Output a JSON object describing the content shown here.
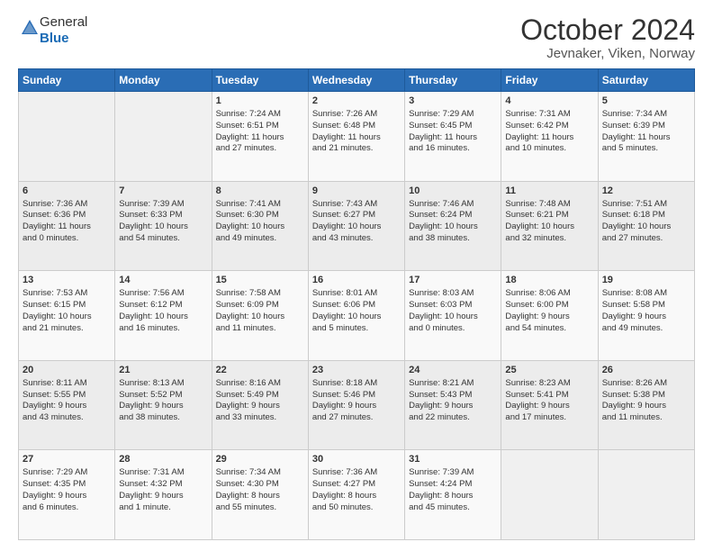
{
  "header": {
    "logo_line1": "General",
    "logo_line2": "Blue",
    "title": "October 2024",
    "subtitle": "Jevnaker, Viken, Norway"
  },
  "days_of_week": [
    "Sunday",
    "Monday",
    "Tuesday",
    "Wednesday",
    "Thursday",
    "Friday",
    "Saturday"
  ],
  "weeks": [
    [
      {
        "day": "",
        "content": ""
      },
      {
        "day": "",
        "content": ""
      },
      {
        "day": "1",
        "content": "Sunrise: 7:24 AM\nSunset: 6:51 PM\nDaylight: 11 hours\nand 27 minutes."
      },
      {
        "day": "2",
        "content": "Sunrise: 7:26 AM\nSunset: 6:48 PM\nDaylight: 11 hours\nand 21 minutes."
      },
      {
        "day": "3",
        "content": "Sunrise: 7:29 AM\nSunset: 6:45 PM\nDaylight: 11 hours\nand 16 minutes."
      },
      {
        "day": "4",
        "content": "Sunrise: 7:31 AM\nSunset: 6:42 PM\nDaylight: 11 hours\nand 10 minutes."
      },
      {
        "day": "5",
        "content": "Sunrise: 7:34 AM\nSunset: 6:39 PM\nDaylight: 11 hours\nand 5 minutes."
      }
    ],
    [
      {
        "day": "6",
        "content": "Sunrise: 7:36 AM\nSunset: 6:36 PM\nDaylight: 11 hours\nand 0 minutes."
      },
      {
        "day": "7",
        "content": "Sunrise: 7:39 AM\nSunset: 6:33 PM\nDaylight: 10 hours\nand 54 minutes."
      },
      {
        "day": "8",
        "content": "Sunrise: 7:41 AM\nSunset: 6:30 PM\nDaylight: 10 hours\nand 49 minutes."
      },
      {
        "day": "9",
        "content": "Sunrise: 7:43 AM\nSunset: 6:27 PM\nDaylight: 10 hours\nand 43 minutes."
      },
      {
        "day": "10",
        "content": "Sunrise: 7:46 AM\nSunset: 6:24 PM\nDaylight: 10 hours\nand 38 minutes."
      },
      {
        "day": "11",
        "content": "Sunrise: 7:48 AM\nSunset: 6:21 PM\nDaylight: 10 hours\nand 32 minutes."
      },
      {
        "day": "12",
        "content": "Sunrise: 7:51 AM\nSunset: 6:18 PM\nDaylight: 10 hours\nand 27 minutes."
      }
    ],
    [
      {
        "day": "13",
        "content": "Sunrise: 7:53 AM\nSunset: 6:15 PM\nDaylight: 10 hours\nand 21 minutes."
      },
      {
        "day": "14",
        "content": "Sunrise: 7:56 AM\nSunset: 6:12 PM\nDaylight: 10 hours\nand 16 minutes."
      },
      {
        "day": "15",
        "content": "Sunrise: 7:58 AM\nSunset: 6:09 PM\nDaylight: 10 hours\nand 11 minutes."
      },
      {
        "day": "16",
        "content": "Sunrise: 8:01 AM\nSunset: 6:06 PM\nDaylight: 10 hours\nand 5 minutes."
      },
      {
        "day": "17",
        "content": "Sunrise: 8:03 AM\nSunset: 6:03 PM\nDaylight: 10 hours\nand 0 minutes."
      },
      {
        "day": "18",
        "content": "Sunrise: 8:06 AM\nSunset: 6:00 PM\nDaylight: 9 hours\nand 54 minutes."
      },
      {
        "day": "19",
        "content": "Sunrise: 8:08 AM\nSunset: 5:58 PM\nDaylight: 9 hours\nand 49 minutes."
      }
    ],
    [
      {
        "day": "20",
        "content": "Sunrise: 8:11 AM\nSunset: 5:55 PM\nDaylight: 9 hours\nand 43 minutes."
      },
      {
        "day": "21",
        "content": "Sunrise: 8:13 AM\nSunset: 5:52 PM\nDaylight: 9 hours\nand 38 minutes."
      },
      {
        "day": "22",
        "content": "Sunrise: 8:16 AM\nSunset: 5:49 PM\nDaylight: 9 hours\nand 33 minutes."
      },
      {
        "day": "23",
        "content": "Sunrise: 8:18 AM\nSunset: 5:46 PM\nDaylight: 9 hours\nand 27 minutes."
      },
      {
        "day": "24",
        "content": "Sunrise: 8:21 AM\nSunset: 5:43 PM\nDaylight: 9 hours\nand 22 minutes."
      },
      {
        "day": "25",
        "content": "Sunrise: 8:23 AM\nSunset: 5:41 PM\nDaylight: 9 hours\nand 17 minutes."
      },
      {
        "day": "26",
        "content": "Sunrise: 8:26 AM\nSunset: 5:38 PM\nDaylight: 9 hours\nand 11 minutes."
      }
    ],
    [
      {
        "day": "27",
        "content": "Sunrise: 7:29 AM\nSunset: 4:35 PM\nDaylight: 9 hours\nand 6 minutes."
      },
      {
        "day": "28",
        "content": "Sunrise: 7:31 AM\nSunset: 4:32 PM\nDaylight: 9 hours\nand 1 minute."
      },
      {
        "day": "29",
        "content": "Sunrise: 7:34 AM\nSunset: 4:30 PM\nDaylight: 8 hours\nand 55 minutes."
      },
      {
        "day": "30",
        "content": "Sunrise: 7:36 AM\nSunset: 4:27 PM\nDaylight: 8 hours\nand 50 minutes."
      },
      {
        "day": "31",
        "content": "Sunrise: 7:39 AM\nSunset: 4:24 PM\nDaylight: 8 hours\nand 45 minutes."
      },
      {
        "day": "",
        "content": ""
      },
      {
        "day": "",
        "content": ""
      }
    ]
  ]
}
